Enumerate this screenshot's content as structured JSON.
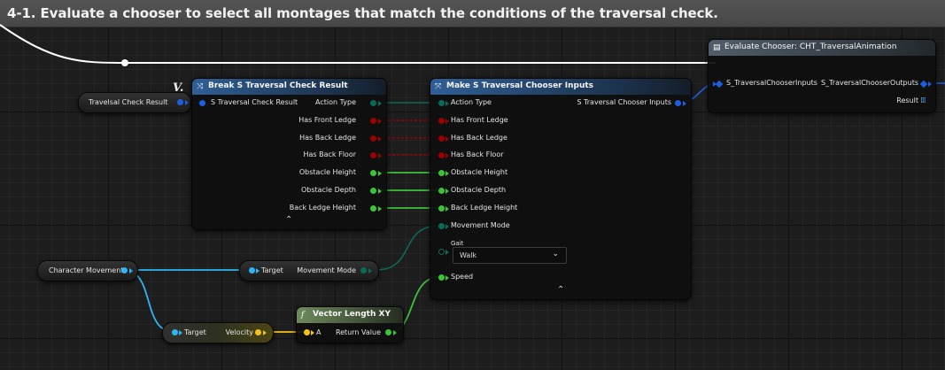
{
  "comment": {
    "title": "4-1. Evaluate a chooser to select all montages that match the conditions of the traversal check."
  },
  "colors": {
    "struct": "#1c5fe0",
    "bool": "#9b0000",
    "float": "#3ec23a",
    "object": "#31b6f5",
    "vector": "#f5c313",
    "enum": "#0a6a5a",
    "exec": "#ffffff"
  },
  "nodes": {
    "travelsal_var": {
      "label": "Travelsal Check Result"
    },
    "break_struct": {
      "title": "Break S Traversal Check Result",
      "input": "S Traversal Check Result",
      "outputs": [
        "Action Type",
        "Has Front Ledge",
        "Has Back Ledge",
        "Has Back Floor",
        "Obstacle Height",
        "Obstacle Depth",
        "Back Ledge Height"
      ],
      "stamp": "V."
    },
    "make_struct": {
      "title": "Make S Traversal Chooser Inputs",
      "inputs": [
        "Action Type",
        "Has Front Ledge",
        "Has Back Ledge",
        "Has Back Floor",
        "Obstacle Height",
        "Obstacle Depth",
        "Back Ledge Height",
        "Movement Mode"
      ],
      "gait_label": "Gait",
      "gait_value": "Walk",
      "speed": "Speed",
      "output": "S Traversal Chooser Inputs"
    },
    "evaluate_chooser": {
      "title": "Evaluate Chooser: CHT_TraversalAnimation",
      "input": "S_TraversalChooserInputs",
      "outputs": [
        "S_TraversalChooserOutputs",
        "Result"
      ]
    },
    "character_movement": {
      "label": "Character Movement"
    },
    "get_movement_mode": {
      "target": "Target",
      "output": "Movement Mode"
    },
    "get_velocity": {
      "target": "Target",
      "output": "Velocity"
    },
    "vector_length": {
      "title": "Vector Length XY",
      "icon": "f",
      "input": "A",
      "output": "Return Value"
    }
  }
}
